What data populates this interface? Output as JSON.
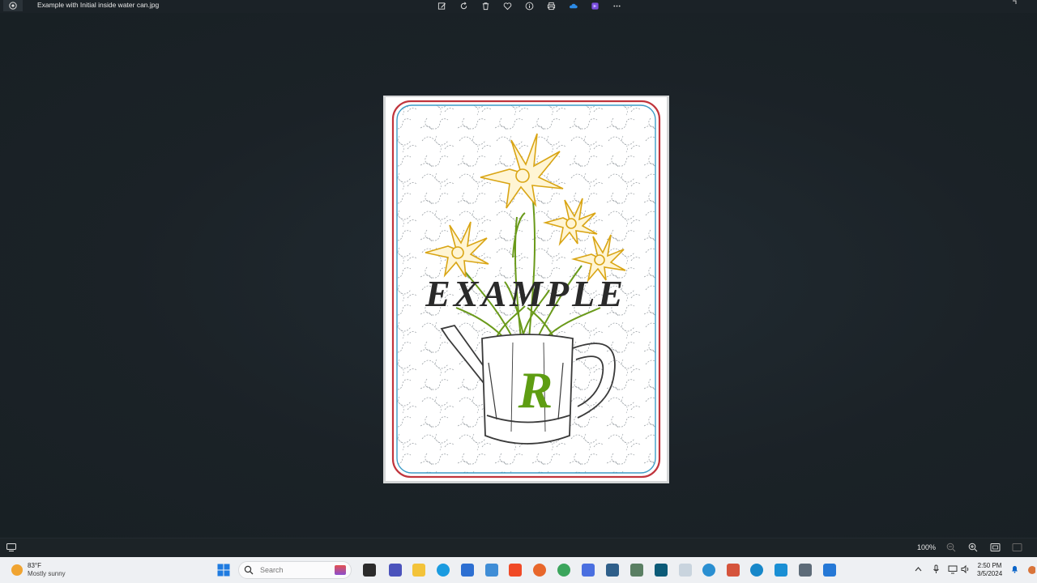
{
  "window": {
    "title": "Example with Initial inside water can.jpg"
  },
  "toolbar": {
    "items": [
      "edit-image",
      "rotate",
      "delete",
      "favorite",
      "file-info",
      "print",
      "onedrive",
      "clipchamp",
      "more"
    ]
  },
  "image": {
    "headline": "EXAMPLE",
    "initial": "R",
    "colors": {
      "outer_border": "#c0353d",
      "inner_border": "#3d9cc7",
      "flower": "#d9a514",
      "leaves": "#6a9a1a",
      "initial": "#5e9d12",
      "headline": "#2a2a2a",
      "can_outline": "#3a3a3a"
    }
  },
  "statusbar": {
    "zoom": "100%"
  },
  "taskbar": {
    "weather": {
      "temperature": "83°F",
      "condition": "Mostly sunny"
    },
    "search_placeholder": "Search",
    "clock": {
      "time": "2:50 PM",
      "date": "3/5/2024"
    },
    "accent": "#0a64c8"
  }
}
